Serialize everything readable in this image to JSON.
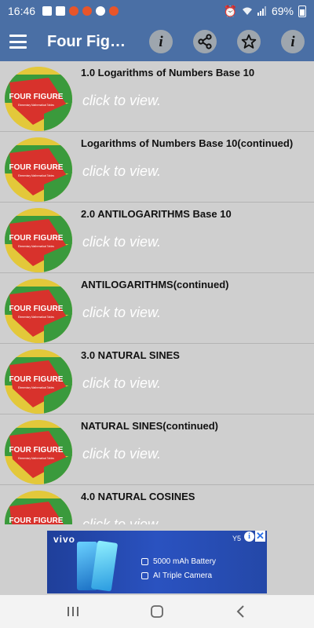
{
  "status_bar": {
    "time": "16:46",
    "battery": "69%"
  },
  "app_bar": {
    "title": "Four Figur…",
    "actions": [
      "info-icon",
      "share-icon",
      "star-icon",
      "info-icon"
    ]
  },
  "list": {
    "items": [
      {
        "title": "1.0 Logarithms of Numbers Base 10",
        "subtitle": "click to view."
      },
      {
        "title": "Logarithms of Numbers Base 10(continued)",
        "subtitle": "click to view."
      },
      {
        "title": "2.0 ANTILOGARITHMS Base 10",
        "subtitle": "click to view."
      },
      {
        "title": "ANTILOGARITHMS(continued)",
        "subtitle": "click to view."
      },
      {
        "title": "3.0 NATURAL SINES",
        "subtitle": "click to view."
      },
      {
        "title": "NATURAL SINES(continued)",
        "subtitle": "click to view."
      },
      {
        "title": "4.0 NATURAL COSINES",
        "subtitle": "click to view."
      }
    ],
    "thumbnail": {
      "label": "FOUR FIGURE",
      "sublabel": "Elementary Mathematical Tables"
    }
  },
  "ad": {
    "brand": "vivo",
    "model": "Y5",
    "line1": "5000 mAh Battery",
    "line2": "AI Triple Camera"
  },
  "colors": {
    "primary": "#4a6fa5",
    "list_bg": "#cfcfcf",
    "thumb_red": "#d8322c",
    "thumb_green": "#3a9a3c",
    "thumb_yellow": "#e3c83a"
  }
}
